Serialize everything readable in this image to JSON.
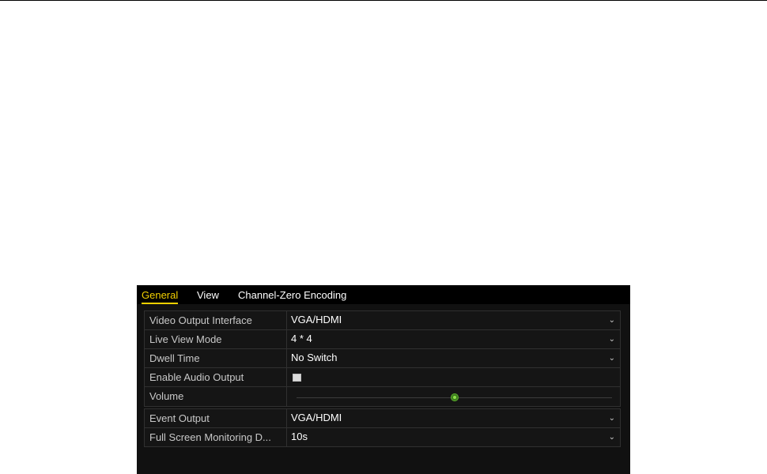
{
  "tabs": [
    {
      "label": "General",
      "active": true
    },
    {
      "label": "View",
      "active": false
    },
    {
      "label": "Channel-Zero Encoding",
      "active": false
    }
  ],
  "settings": {
    "video_output_interface": {
      "label": "Video Output Interface",
      "value": "VGA/HDMI",
      "icon": "chevron-down-icon"
    },
    "live_view_mode": {
      "label": "Live View Mode",
      "value": "4 * 4",
      "icon": "chevron-down-icon"
    },
    "dwell_time": {
      "label": "Dwell Time",
      "value": "No Switch",
      "icon": "chevron-down-icon"
    },
    "enable_audio_output": {
      "label": "Enable Audio Output",
      "checked": false
    },
    "volume": {
      "label": "Volume",
      "level_fraction": 0.5
    },
    "event_output": {
      "label": "Event Output",
      "value": "VGA/HDMI",
      "icon": "chevron-down-icon"
    },
    "full_screen_monitoring": {
      "label": "Full Screen Monitoring D...",
      "value": "10s",
      "icon": "chevron-down-icon"
    }
  },
  "colors": {
    "accent": "#f2d000",
    "slider_thumb": "#3b7a1e",
    "panel_background": "#111111"
  }
}
